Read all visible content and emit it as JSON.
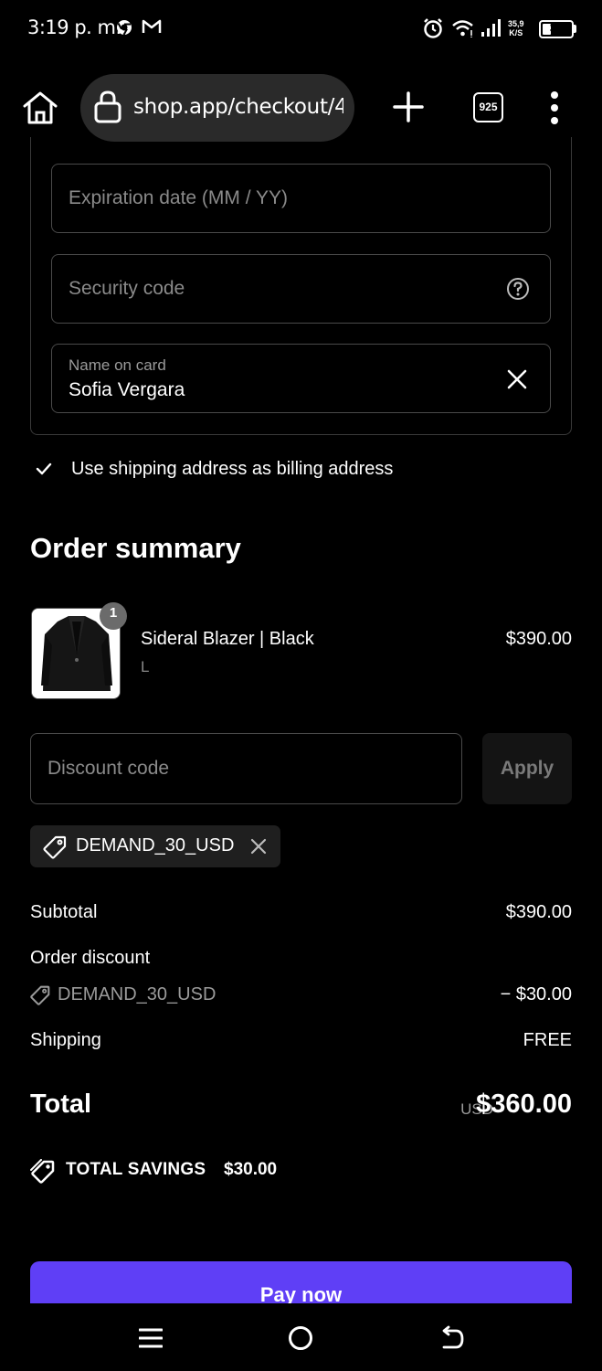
{
  "status_bar": {
    "time": "3:19 p. m.",
    "speed_value": "35,9",
    "speed_unit": "K/S",
    "battery": "30",
    "battery_level": 0.3
  },
  "browser": {
    "url": "shop.app/checkout/4",
    "tabs_count": "925"
  },
  "payment_form": {
    "expiration_placeholder": "Expiration date (MM / YY)",
    "security_placeholder": "Security code",
    "name_label": "Name on card",
    "name_value": "Sofia Vergara",
    "billing_checkbox_label": "Use shipping address as billing address",
    "billing_checked": true
  },
  "order_summary": {
    "title": "Order summary",
    "item": {
      "name": "Sideral Blazer | Black",
      "variant": "L",
      "price": "$390.00",
      "quantity": "1"
    },
    "discount": {
      "placeholder": "Discount code",
      "apply_label": "Apply",
      "applied_code": "DEMAND_30_USD"
    },
    "totals": {
      "subtotal_label": "Subtotal",
      "subtotal_value": "$390.00",
      "order_discount_label": "Order discount",
      "discount_code": "DEMAND_30_USD",
      "discount_value": "− $30.00",
      "shipping_label": "Shipping",
      "shipping_value": "FREE",
      "total_label": "Total",
      "currency": "USD",
      "total_value": "$360.00"
    },
    "savings": {
      "label": "TOTAL SAVINGS",
      "amount": "$30.00"
    },
    "pay_button": "Pay now"
  },
  "colors": {
    "accent": "#5f3ff6",
    "background": "#000000",
    "field_border": "#4a4a4a"
  }
}
